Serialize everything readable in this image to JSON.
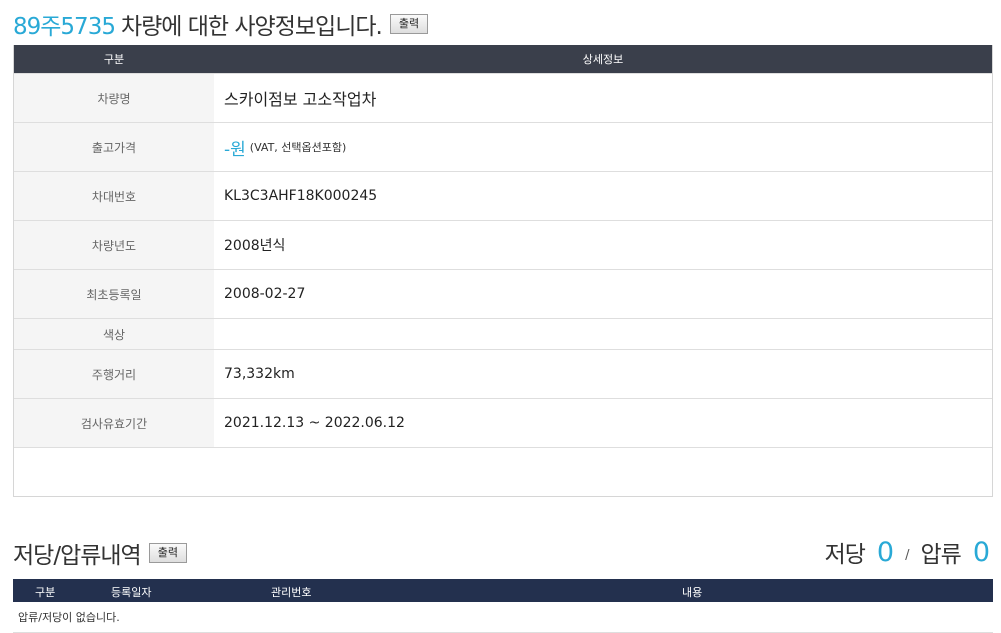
{
  "spec": {
    "plate": "89주5735",
    "title_rest": "차량에 대한 사양정보입니다.",
    "print_label": "출력",
    "header": {
      "col1": "구분",
      "col2": "상세정보"
    },
    "rows": {
      "name": {
        "label": "차량명",
        "value": "스카이점보 고소작업차"
      },
      "price": {
        "label": "출고가격",
        "value": "-원",
        "note": "(VAT, 선택옵션포함)"
      },
      "vin": {
        "label": "차대번호",
        "value": "KL3C3AHF18K000245"
      },
      "year": {
        "label": "차량년도",
        "value": "2008년식"
      },
      "first_reg": {
        "label": "최초등록일",
        "value": "2008-02-27"
      },
      "color": {
        "label": "색상",
        "value": ""
      },
      "mileage": {
        "label": "주행거리",
        "value": "73,332km"
      },
      "inspection": {
        "label": "검사유효기간",
        "value": "2021.12.13 ~ 2022.06.12"
      }
    }
  },
  "lien": {
    "title": "저당/압류내역",
    "print_label": "출력",
    "mortgage_label": "저당",
    "mortgage_count": "0",
    "separator": "/",
    "seizure_label": "압류",
    "seizure_count": "0",
    "columns": [
      "구분",
      "등록일자",
      "관리번호",
      "내용"
    ],
    "empty_message": "압류/저당이 없습니다."
  },
  "colors": {
    "accent": "#29a9d6",
    "header_dark": "#3a3f4b",
    "header_navy": "#23304e"
  }
}
